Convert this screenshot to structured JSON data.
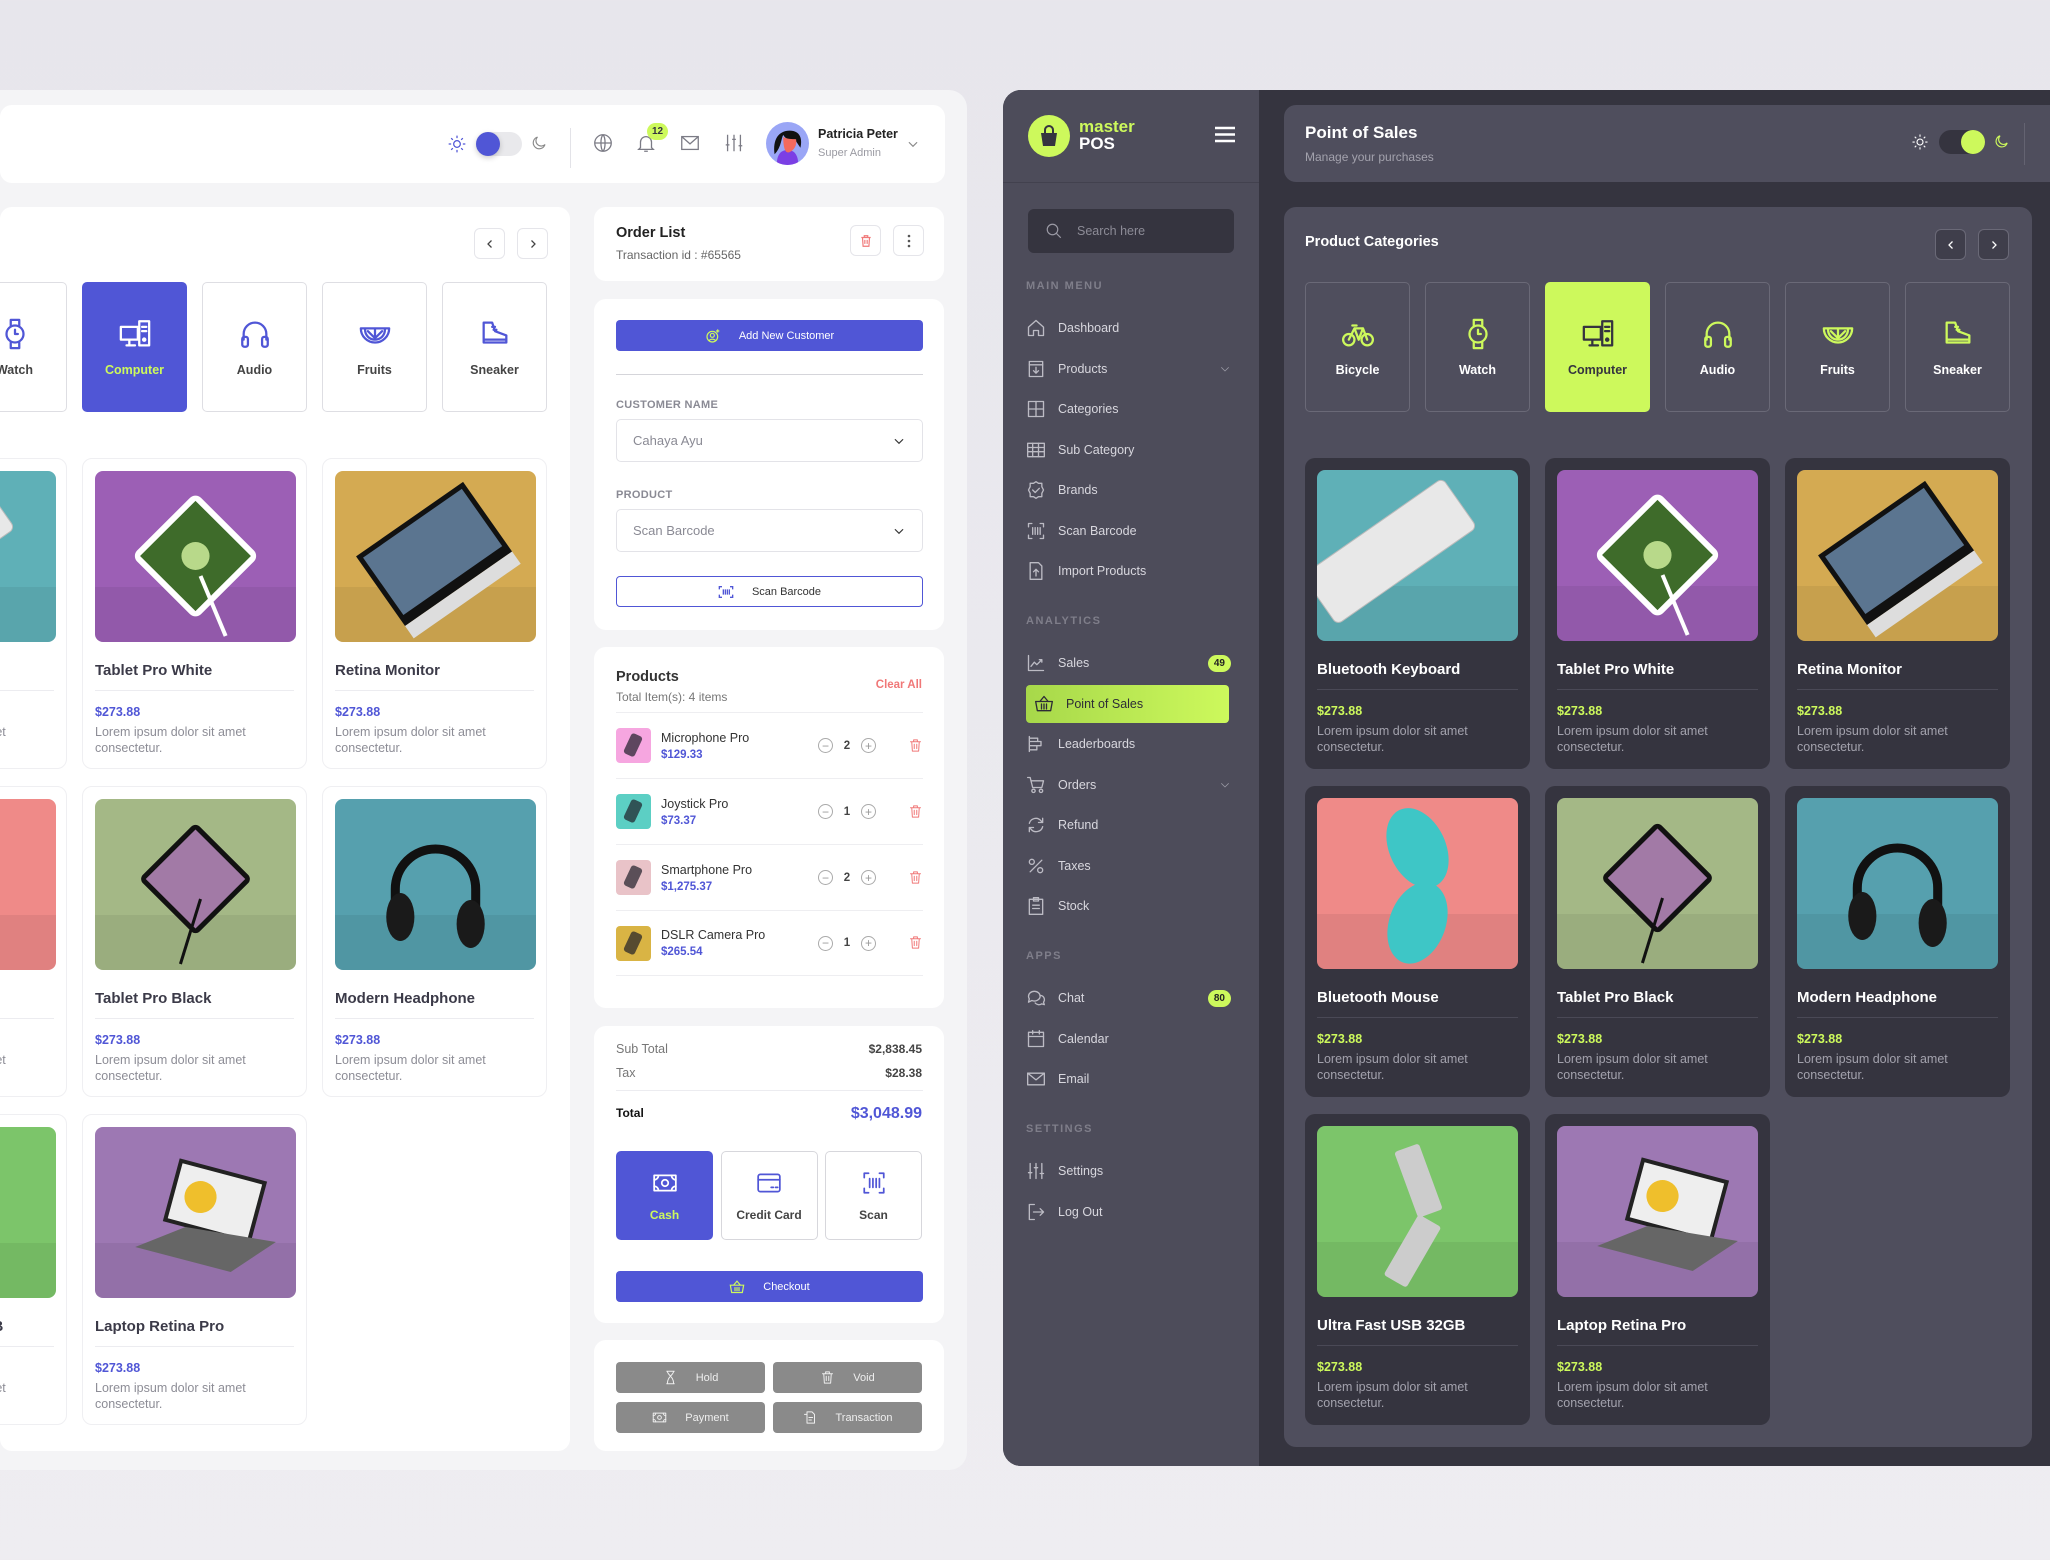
{
  "colors": {
    "primary": "#5056d6",
    "accent": "#cdf95c",
    "danger": "#f07878",
    "dark_bg": "#35343f",
    "dark_surface": "#4f4e5d"
  },
  "categories": [
    {
      "label": "Bicycle",
      "icon": "bicycle-icon"
    },
    {
      "label": "Watch",
      "icon": "watch-icon"
    },
    {
      "label": "Computer",
      "icon": "computer-icon",
      "active": true
    },
    {
      "label": "Audio",
      "icon": "headphones-icon"
    },
    {
      "label": "Fruits",
      "icon": "fruit-icon"
    },
    {
      "label": "Sneaker",
      "icon": "sneaker-icon"
    }
  ],
  "products": [
    {
      "name": "Bluetooth Keyboard",
      "price": "$273.88",
      "desc": "Lorem ipsum dolor sit amet consectetur.",
      "bg": "#5fb0b7",
      "image": "keyboard"
    },
    {
      "name": "Tablet Pro White",
      "price": "$273.88",
      "desc": "Lorem ipsum dolor sit amet consectetur.",
      "bg": "#9c5fb5",
      "image": "tablet-white"
    },
    {
      "name": "Retina Monitor",
      "price": "$273.88",
      "desc": "Lorem ipsum dolor sit amet consectetur.",
      "bg": "#d4aa52",
      "image": "monitor"
    },
    {
      "name": "Bluetooth Mouse",
      "price": "$273.88",
      "desc": "Lorem ipsum dolor sit amet consectetur.",
      "bg": "#ef8a88",
      "image": "mouse"
    },
    {
      "name": "Tablet Pro Black",
      "price": "$273.88",
      "desc": "Lorem ipsum dolor sit amet consectetur.",
      "bg": "#a4b886",
      "image": "tablet-black"
    },
    {
      "name": "Modern Headphone",
      "price": "$273.88",
      "desc": "Lorem ipsum dolor sit amet consectetur.",
      "bg": "#56a0ae",
      "image": "headphone"
    },
    {
      "name": "Ultra Fast USB 32GB",
      "price": "$273.88",
      "desc": "Lorem ipsum dolor sit amet consectetur.",
      "bg": "#7cc56a",
      "image": "usb"
    },
    {
      "name": "Laptop Retina Pro",
      "price": "$273.88",
      "desc": "Lorem ipsum dolor sit amet consectetur.",
      "bg": "#9d78b3",
      "image": "laptop"
    }
  ],
  "light": {
    "header": {
      "notifications": "12",
      "user_name": "Patricia Peter",
      "user_role": "Super Admin",
      "theme": "light"
    },
    "order": {
      "title": "Order List",
      "transaction": "Transaction id : #65565",
      "add_customer": "Add New Customer",
      "customer_label": "CUSTOMER NAME",
      "customer_value": "Cahaya Ayu",
      "product_label": "PRODUCT",
      "product_placeholder": "Scan Barcode",
      "scan_button": "Scan Barcode"
    },
    "cart": {
      "title": "Products",
      "total_items": "Total Item(s): 4 items",
      "clear_all": "Clear All",
      "items": [
        {
          "name": "Microphone Pro",
          "price": "$129.33",
          "qty": "2",
          "bg": "#f6a6e0"
        },
        {
          "name": "Joystick Pro",
          "price": "$73.37",
          "qty": "1",
          "bg": "#5ccfc4"
        },
        {
          "name": "Smartphone Pro",
          "price": "$1,275.37",
          "qty": "2",
          "bg": "#e9c3c8"
        },
        {
          "name": "DSLR Camera Pro",
          "price": "$265.54",
          "qty": "1",
          "bg": "#d9b444"
        }
      ]
    },
    "totals": {
      "sub_total_label": "Sub Total",
      "sub_total": "$2,838.45",
      "tax_label": "Tax",
      "tax": "$28.38",
      "total_label": "Total",
      "total": "$3,048.99"
    },
    "payment_methods": [
      {
        "label": "Cash",
        "icon": "cash-icon",
        "active": true
      },
      {
        "label": "Credit Card",
        "icon": "credit-card-icon"
      },
      {
        "label": "Scan",
        "icon": "barcode-icon"
      }
    ],
    "checkout": "Checkout",
    "actions": [
      {
        "label": "Hold",
        "icon": "hourglass-icon"
      },
      {
        "label": "Void",
        "icon": "trash-icon"
      },
      {
        "label": "Payment",
        "icon": "cash-icon"
      },
      {
        "label": "Transaction",
        "icon": "receipt-icon"
      }
    ]
  },
  "dark": {
    "logo": {
      "line1": "master",
      "line2": "POS"
    },
    "search_placeholder": "Search here",
    "menu": [
      {
        "section": "MAIN MENU",
        "items": [
          {
            "label": "Dashboard",
            "icon": "home-icon"
          },
          {
            "label": "Products",
            "icon": "box-icon",
            "chevron": true
          },
          {
            "label": "Categories",
            "icon": "grid-icon"
          },
          {
            "label": "Sub Category",
            "icon": "table-icon"
          },
          {
            "label": "Brands",
            "icon": "badge-check-icon"
          },
          {
            "label": "Scan Barcode",
            "icon": "barcode-icon"
          },
          {
            "label": "Import Products",
            "icon": "file-upload-icon"
          }
        ]
      },
      {
        "section": "ANALYTICS",
        "items": [
          {
            "label": "Sales",
            "icon": "chart-line-icon",
            "badge": "49"
          },
          {
            "label": "Point of Sales",
            "icon": "basket-icon",
            "active": true
          },
          {
            "label": "Leaderboards",
            "icon": "leaderboard-icon"
          },
          {
            "label": "Orders",
            "icon": "cart-icon",
            "chevron": true
          },
          {
            "label": "Refund",
            "icon": "refresh-icon"
          },
          {
            "label": "Taxes",
            "icon": "percent-icon"
          },
          {
            "label": "Stock",
            "icon": "clipboard-icon"
          }
        ]
      },
      {
        "section": "APPS",
        "items": [
          {
            "label": "Chat",
            "icon": "chat-icon",
            "badge": "80"
          },
          {
            "label": "Calendar",
            "icon": "calendar-icon"
          },
          {
            "label": "Email",
            "icon": "mail-icon"
          }
        ]
      },
      {
        "section": "SETTINGS",
        "items": [
          {
            "label": "Settings",
            "icon": "sliders-icon"
          },
          {
            "label": "Log Out",
            "icon": "logout-icon"
          }
        ]
      }
    ],
    "header": {
      "title": "Point of Sales",
      "subtitle": "Manage your purchases",
      "theme": "dark"
    },
    "categories_title": "Product Categories"
  }
}
